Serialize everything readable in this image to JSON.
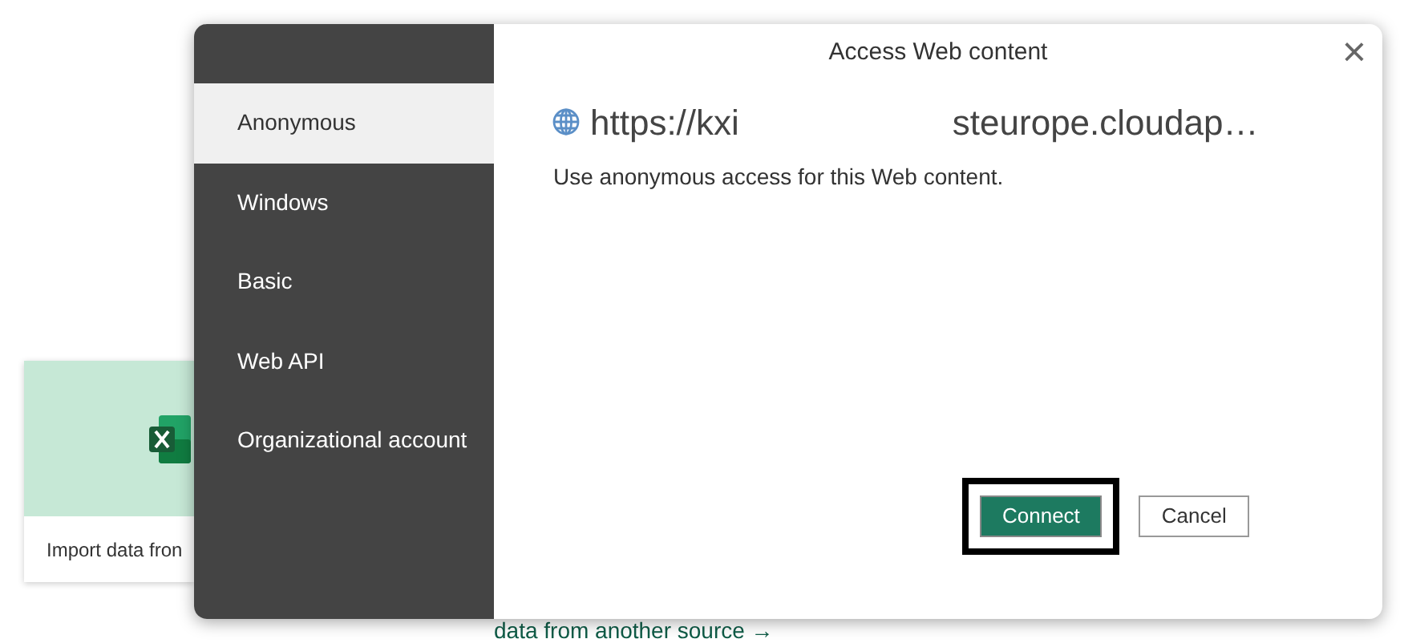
{
  "background": {
    "card": {
      "label": "Import data fron"
    },
    "link": "data from another source →"
  },
  "dialog": {
    "title": "Access Web content",
    "close": "×",
    "auth_methods": [
      {
        "label": "Anonymous",
        "selected": true
      },
      {
        "label": "Windows",
        "selected": false
      },
      {
        "label": "Basic",
        "selected": false
      },
      {
        "label": "Web API",
        "selected": false
      },
      {
        "label": "Organizational account",
        "selected": false
      }
    ],
    "url_start": "https://kxi",
    "url_end": "steurope.cloudap…",
    "description": "Use anonymous access for this Web content.",
    "buttons": [
      {
        "label": "Connect",
        "kind": "primary",
        "highlighted": true
      },
      {
        "label": "Cancel",
        "kind": "secondary",
        "highlighted": false
      }
    ]
  }
}
